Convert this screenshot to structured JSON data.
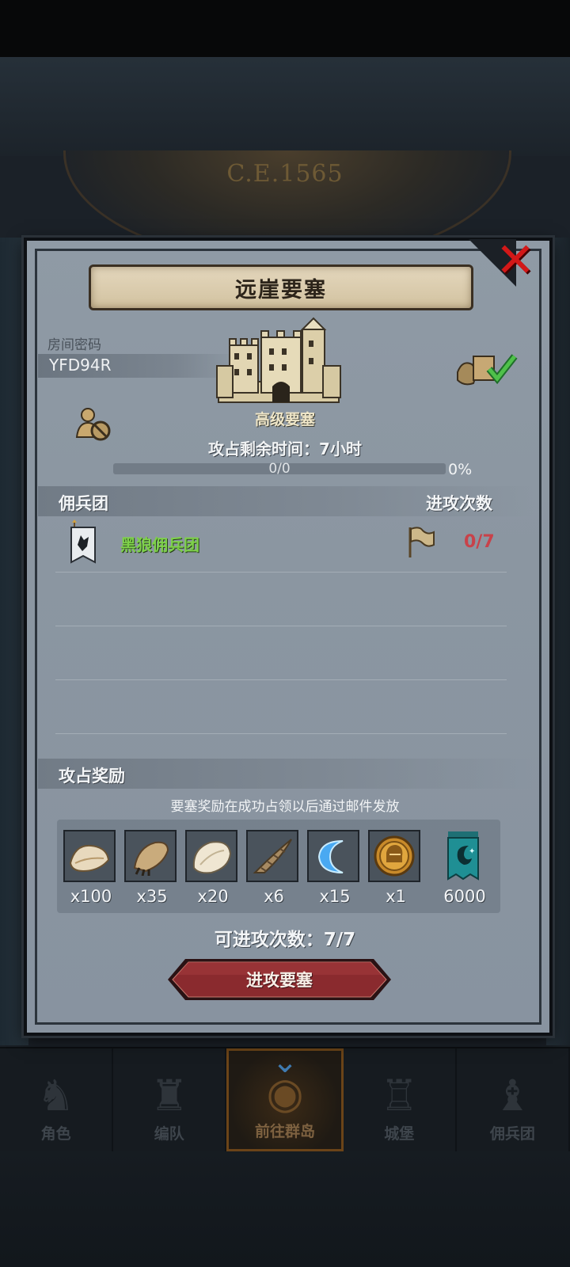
{
  "background": {
    "year_label": "C.E.1565"
  },
  "dialog": {
    "title": "远崖要塞",
    "room_password_label": "房间密码",
    "room_password": "YFD94R",
    "fortress_level": "高级要塞",
    "timer_text": "攻占剩余时间：7小时",
    "progress": {
      "text": "0/0",
      "percent_label": "0%",
      "fraction": 0
    }
  },
  "mercenary_section": {
    "left_header": "佣兵团",
    "right_header": "进攻次数",
    "rows": [
      {
        "name": "黑狼佣兵团",
        "attack_count": "0/7"
      }
    ]
  },
  "reward_section": {
    "header": "攻占奖励",
    "note": "要塞奖励在成功占领以后通过邮件发放",
    "items": [
      {
        "icon": "fur-pelt-icon",
        "qty": "x100"
      },
      {
        "icon": "claw-icon",
        "qty": "x35"
      },
      {
        "icon": "white-fur-icon",
        "qty": "x20"
      },
      {
        "icon": "horn-icon",
        "qty": "x6"
      },
      {
        "icon": "blue-crescent-icon",
        "qty": "x15"
      },
      {
        "icon": "knight-coin-icon",
        "qty": "x1"
      },
      {
        "icon": "guild-banner-icon",
        "qty": "6000"
      }
    ]
  },
  "attempts_text": "可进攻次数：7/7",
  "attack_button": "进攻要塞",
  "bottom_nav": [
    {
      "label": "角色",
      "active": false
    },
    {
      "label": "编队",
      "active": false
    },
    {
      "label": "前往群岛",
      "active": true
    },
    {
      "label": "城堡",
      "active": false
    },
    {
      "label": "佣兵团",
      "active": false
    }
  ],
  "colors": {
    "merc_name": "#7ed14a",
    "attack_count": "#c8424a",
    "close_x": "#d21818",
    "button_red": "#8a2a2e"
  }
}
